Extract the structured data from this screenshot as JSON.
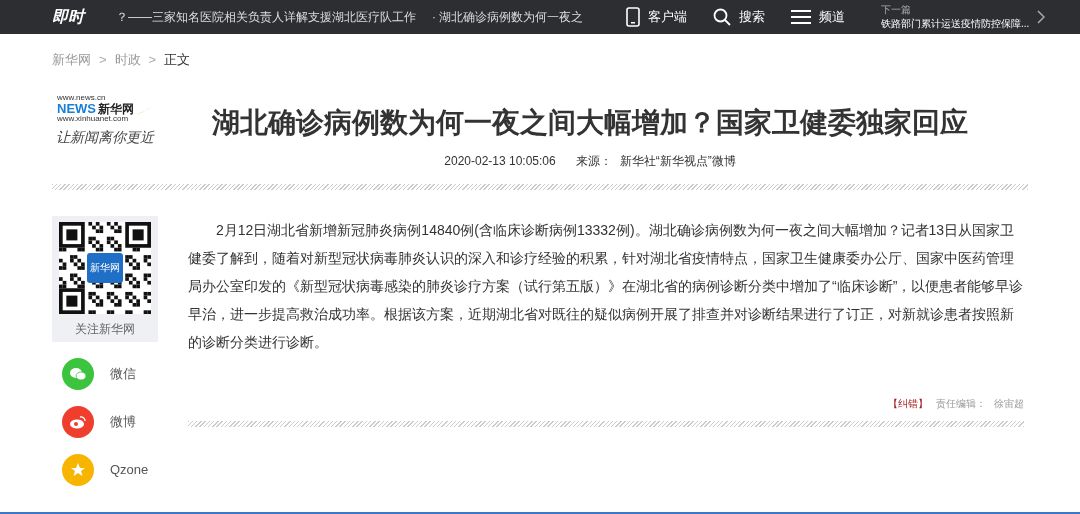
{
  "top_bar": {
    "logo": "即时",
    "ticker": [
      {
        "text": "？——三家知名医院相关负责人详解支援湖北医疗队工作"
      },
      {
        "text": "· 湖北确诊病例数为何一夜之"
      }
    ],
    "actions": [
      {
        "kind": "phone",
        "label": "客户端"
      },
      {
        "kind": "search",
        "label": "搜索"
      },
      {
        "kind": "menu",
        "label": "频道"
      }
    ],
    "next": {
      "label": "下一篇",
      "title": "铁路部门累计运送疫情防控保障..."
    }
  },
  "breadcrumb": [
    {
      "text": "新华网",
      "selected": false
    },
    {
      "text": "时政",
      "selected": false
    },
    {
      "text": "正文",
      "selected": true
    }
  ],
  "breadcrumb_separator": ">",
  "logo": {
    "url": "www.news.cn",
    "name": "新华网",
    "news": "NEWS",
    "site": "www.xinhuanet.com",
    "slogan": "让新闻离你更近"
  },
  "article": {
    "title": "湖北确诊病例数为何一夜之间大幅增加？国家卫健委独家回应",
    "date": "2020-02-13 10:05:06",
    "source_label": "来源：",
    "source": "新华社“新华视点”微博",
    "body": "2月12日湖北省新增新冠肺炎病例14840例(含临床诊断病例13332例)。湖北确诊病例数为何一夜之间大幅增加？记者13日从国家卫健委了解到，随着对新型冠状病毒肺炎认识的深入和诊疗经验的积累，针对湖北省疫情特点，国家卫生健康委办公厅、国家中医药管理局办公室印发的《新型冠状病毒感染的肺炎诊疗方案（试行第五版）》在湖北省的病例诊断分类中增加了“临床诊断”，以便患者能够早诊早治，进一步提高救治成功率。根据该方案，近期湖北省对既往的疑似病例开展了排查并对诊断结果进行了订正，对新就诊患者按照新的诊断分类进行诊断。",
    "correction": "【纠错】",
    "editor_label": "责任编辑：",
    "editor": "徐宙超"
  },
  "qr": {
    "badge": "新华网",
    "caption": "关注新华网"
  },
  "share": [
    {
      "kind": "wechat",
      "label": "微信",
      "color": "#3cc43f"
    },
    {
      "kind": "weibo",
      "label": "微博",
      "color": "#ef3e2e"
    },
    {
      "kind": "qzone",
      "label": "Qzone",
      "color": "#f8b500"
    }
  ]
}
